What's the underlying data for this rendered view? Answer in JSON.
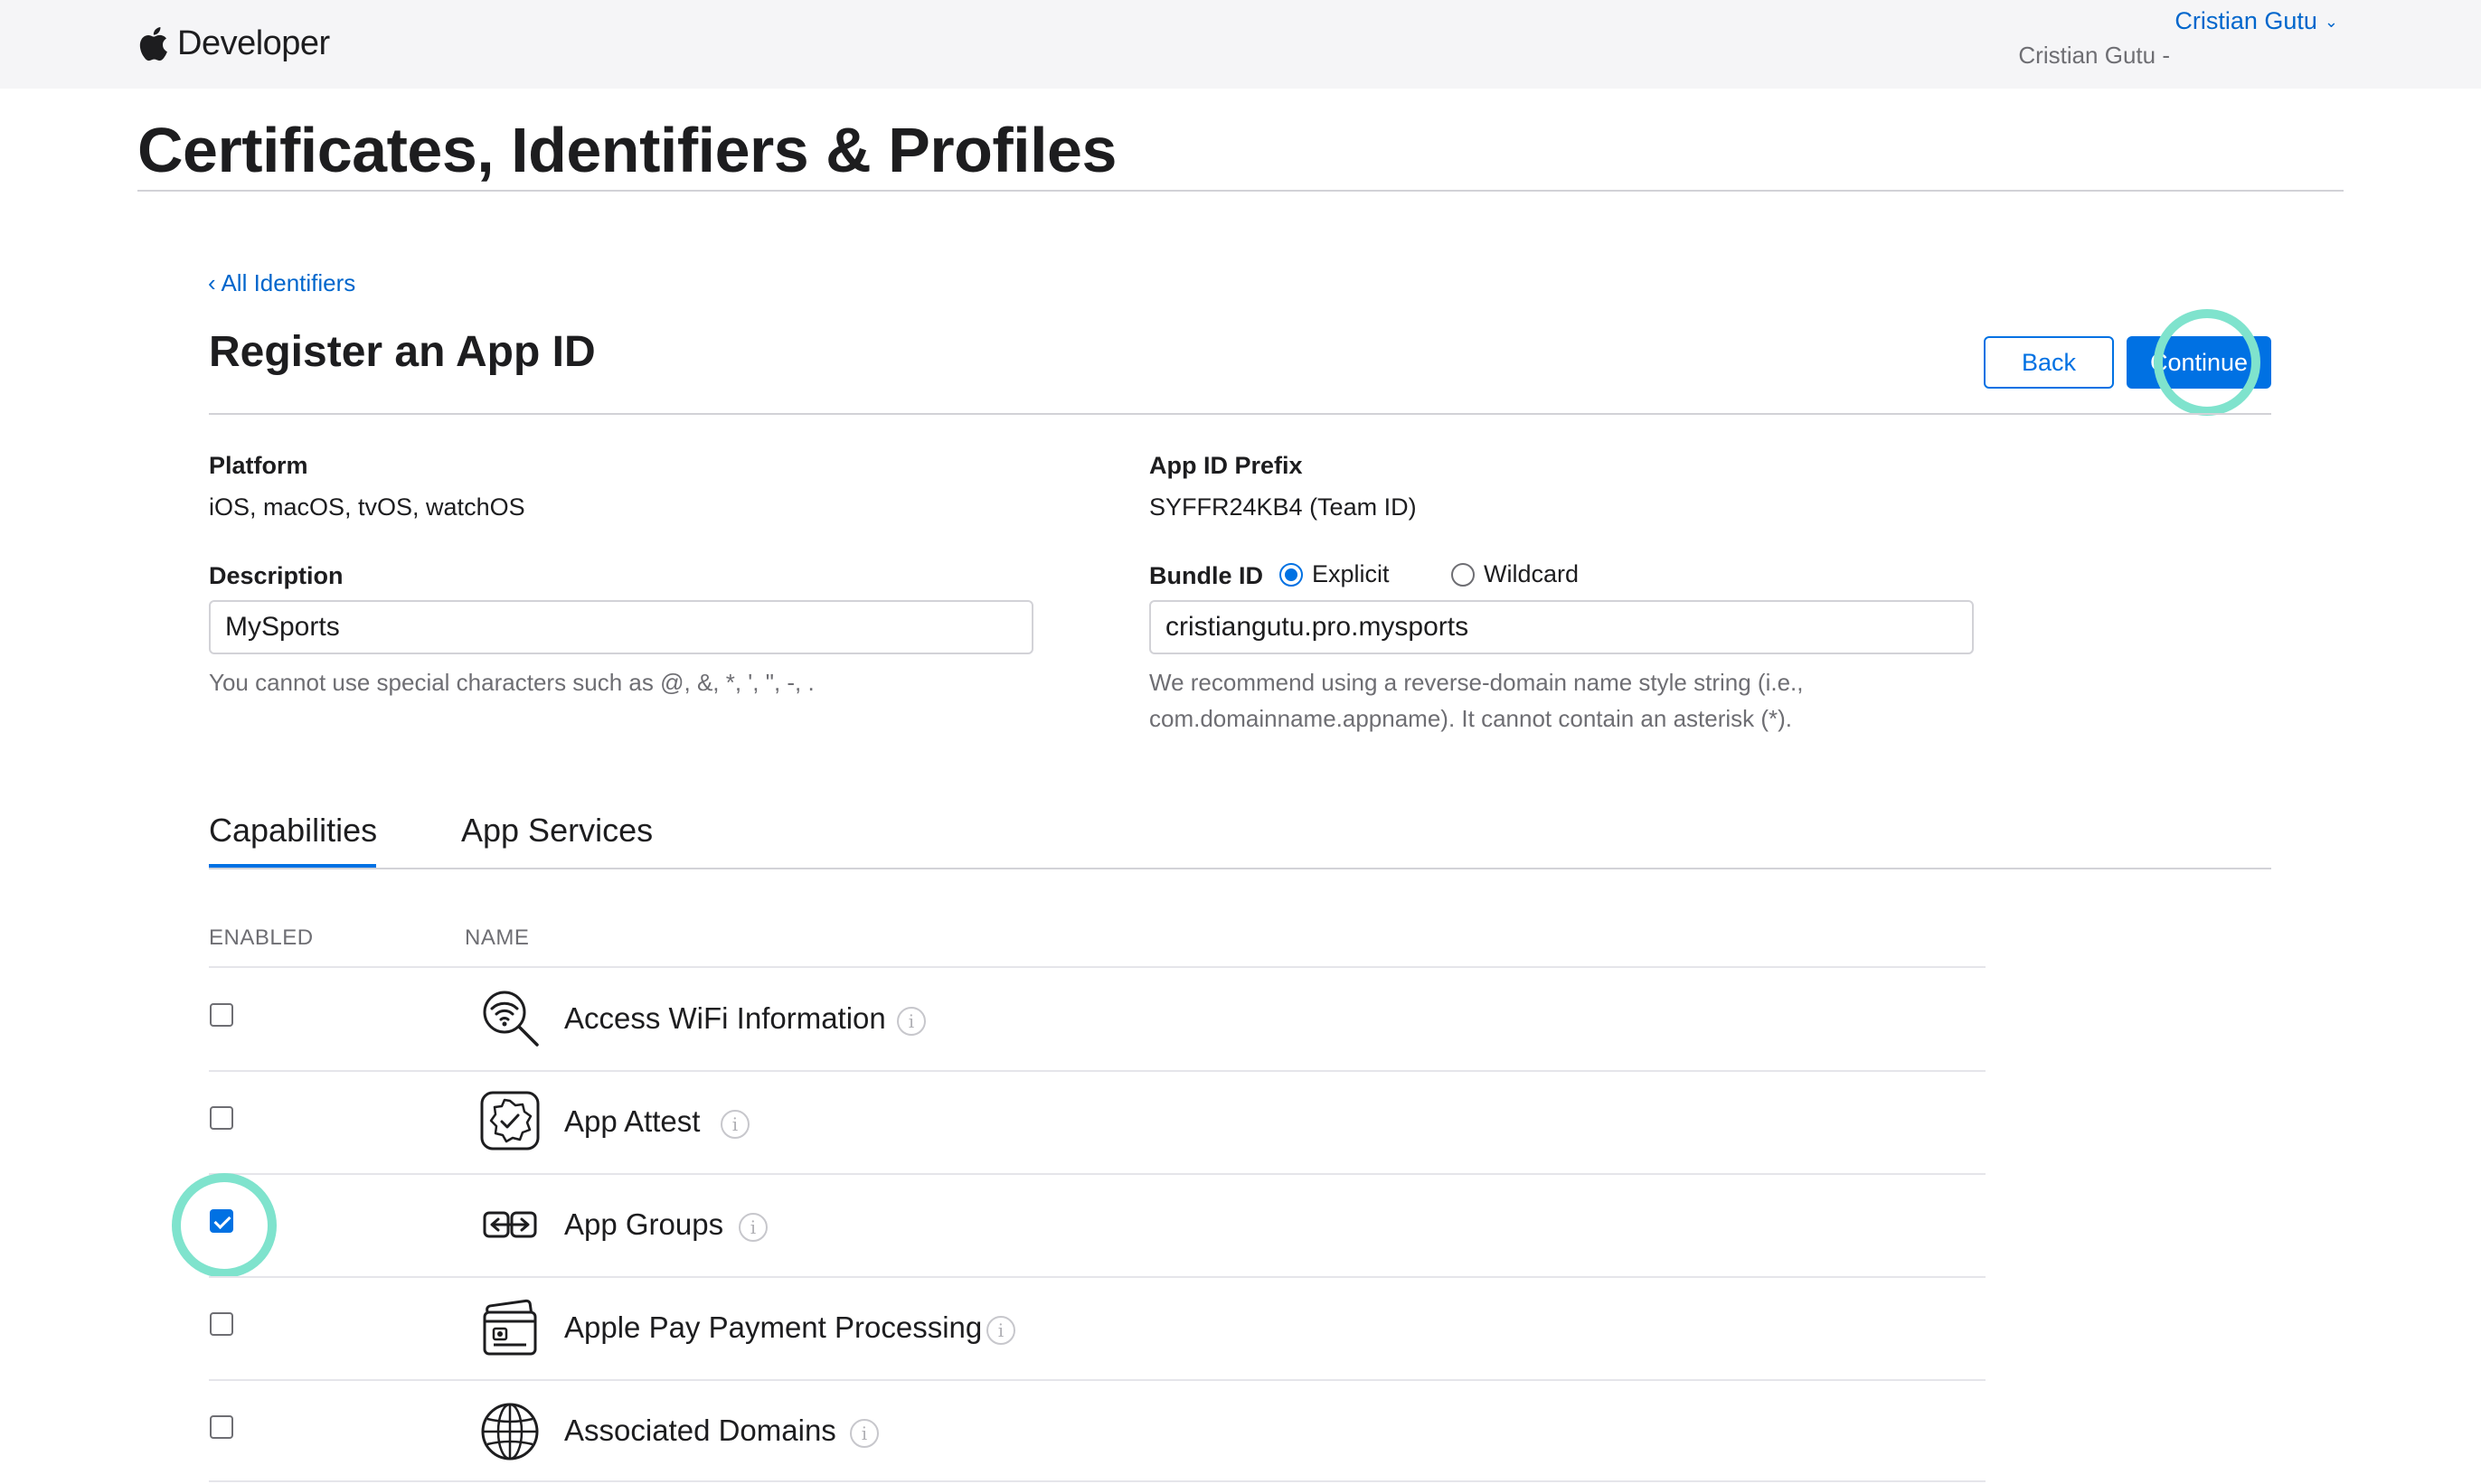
{
  "header": {
    "brand": "Developer",
    "user_name": "Cristian Gutu",
    "team_name": "Cristian Gutu -"
  },
  "page": {
    "title": "Certificates, Identifiers & Profiles",
    "back_link": "‹ All Identifiers",
    "section_title": "Register an App ID",
    "back_button": "Back",
    "continue_button": "Continue"
  },
  "form": {
    "platform_label": "Platform",
    "platform_value": "iOS, macOS, tvOS, watchOS",
    "prefix_label": "App ID Prefix",
    "prefix_value": "SYFFR24KB4 (Team ID)",
    "description_label": "Description",
    "description_value": "MySports",
    "description_hint": "You cannot use special characters such as @, &, *, ', \", -, .",
    "bundle_label": "Bundle ID",
    "bundle_explicit": "Explicit",
    "bundle_wildcard": "Wildcard",
    "bundle_value": "cristiangutu.pro.mysports",
    "bundle_hint": "We recommend using a reverse-domain name style string (i.e., com.domainname.appname). It cannot contain an asterisk (*)."
  },
  "tabs": {
    "capabilities": "Capabilities",
    "app_services": "App Services"
  },
  "table": {
    "col_enabled": "ENABLED",
    "col_name": "NAME",
    "rows": [
      {
        "name": "Access WiFi Information",
        "enabled": false,
        "icon": "wifi-search-icon"
      },
      {
        "name": "App Attest",
        "enabled": false,
        "icon": "badge-check-icon"
      },
      {
        "name": "App Groups",
        "enabled": true,
        "icon": "app-groups-icon"
      },
      {
        "name": "Apple Pay Payment Processing",
        "enabled": false,
        "icon": "payment-card-icon"
      },
      {
        "name": "Associated Domains",
        "enabled": false,
        "icon": "globe-icon"
      }
    ]
  },
  "colors": {
    "accent": "#0071e3",
    "link": "#0066cc",
    "highlight_ring": "#7fe3cd"
  }
}
